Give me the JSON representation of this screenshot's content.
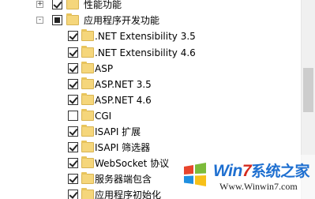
{
  "tree": {
    "items": [
      {
        "label": "性能功能",
        "checked": "checked",
        "expander": "+"
      },
      {
        "label": "应用程序开发功能",
        "checked": "partial",
        "expander": "-"
      },
      {
        "label": ".NET Extensibility 3.5",
        "checked": "checked"
      },
      {
        "label": ".NET Extensibility 4.6",
        "checked": "checked"
      },
      {
        "label": "ASP",
        "checked": "checked"
      },
      {
        "label": "ASP.NET 3.5",
        "checked": "checked"
      },
      {
        "label": "ASP.NET 4.6",
        "checked": "checked"
      },
      {
        "label": "CGI",
        "checked": "unchecked"
      },
      {
        "label": "ISAPI 扩展",
        "checked": "checked"
      },
      {
        "label": "ISAPI 筛选器",
        "checked": "checked"
      },
      {
        "label": "WebSocket 协议",
        "checked": "checked"
      },
      {
        "label": "服务器端包含",
        "checked": "checked"
      },
      {
        "label": "应用程序初始化",
        "checked": "checked"
      }
    ]
  },
  "watermark": {
    "title_prefix": "Win",
    "title_seven": "7",
    "title_suffix": "系统之家",
    "url": "Www.Winwin7.com"
  },
  "colors": {
    "folder": "#f5d67b",
    "watermark_blue": "#1e6fd0",
    "watermark_red": "#d42a1e"
  }
}
